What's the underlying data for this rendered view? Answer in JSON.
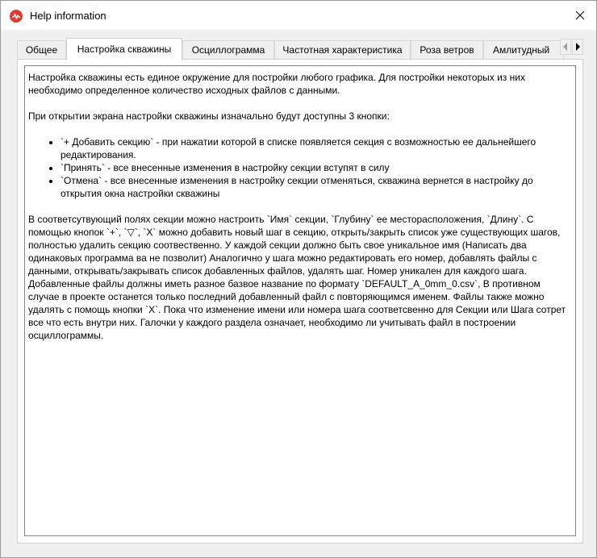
{
  "window": {
    "title": "Help information",
    "icon": "app-logo-icon",
    "close_icon": "close-icon",
    "accent_color": "#e03a2f"
  },
  "tabs": [
    {
      "label": "Общее",
      "active": false
    },
    {
      "label": "Настройка скважины",
      "active": true
    },
    {
      "label": "Осциллограмма",
      "active": false
    },
    {
      "label": "Частотная характеристика",
      "active": false
    },
    {
      "label": "Роза ветров",
      "active": false
    },
    {
      "label": "Амлитудный",
      "active": false
    }
  ],
  "tab_scroll": {
    "left_icon": "scroll-left-icon",
    "right_icon": "scroll-right-icon"
  },
  "content": {
    "intro": "Настройка скважины есть единое окружение для постройки любого графика. Для постройки некоторых из них необходимо определенное количество исходных файлов с данными.",
    "buttons_intro": "При открытии экрана настройки скважины изначально будут доступны 3 кнопки:",
    "bullets": [
      "`+ Добавить секцию` - при нажатии которой в списке появляется секция с возможностью ее дальнейшего редактирования.",
      "`Принять` - все внесенные изменения в настройку секции вступят в силу",
      "`Отмена` - все внесенные изменения в настройку секции отменяться, скважина вернется в настройку до открытия окна настройки скважины"
    ],
    "details": "В соответсутвующий полях секции можно настроить `Имя` секции, `Глубину` ее месторасположения, `Длину`. С помощью кнопок `+`, `▽`, `X` можно добавить новый шаг в секцию, открыть/закрыть список уже существующих шагов, полностью удалить секцию соотвественно. У каждой секции должно быть свое уникальное имя (Написать два одинаковых программа ва не позволит) Аналогично у шага можно редактировать его номер, добавлять файлы с данными, открывать/закрывать список добавленных файлов, удалять шаг. Номер уникален для каждого шага. Добавленные файлы должны иметь разное базвое название по формату `DEFAULT_A_0mm_0.csv`, В противном случае в проекте останется только последний добавленный файл с повторяющимся именем. Файлы также можно удалять с помощь кнопки `X`. Пока что изменение имени или номера шага соответсвенно для Секции или Шага сотрет все что есть внутри них. Галочки у каждого раздела означает, необходимо ли учитывать файл в построении осциллограммы."
  }
}
